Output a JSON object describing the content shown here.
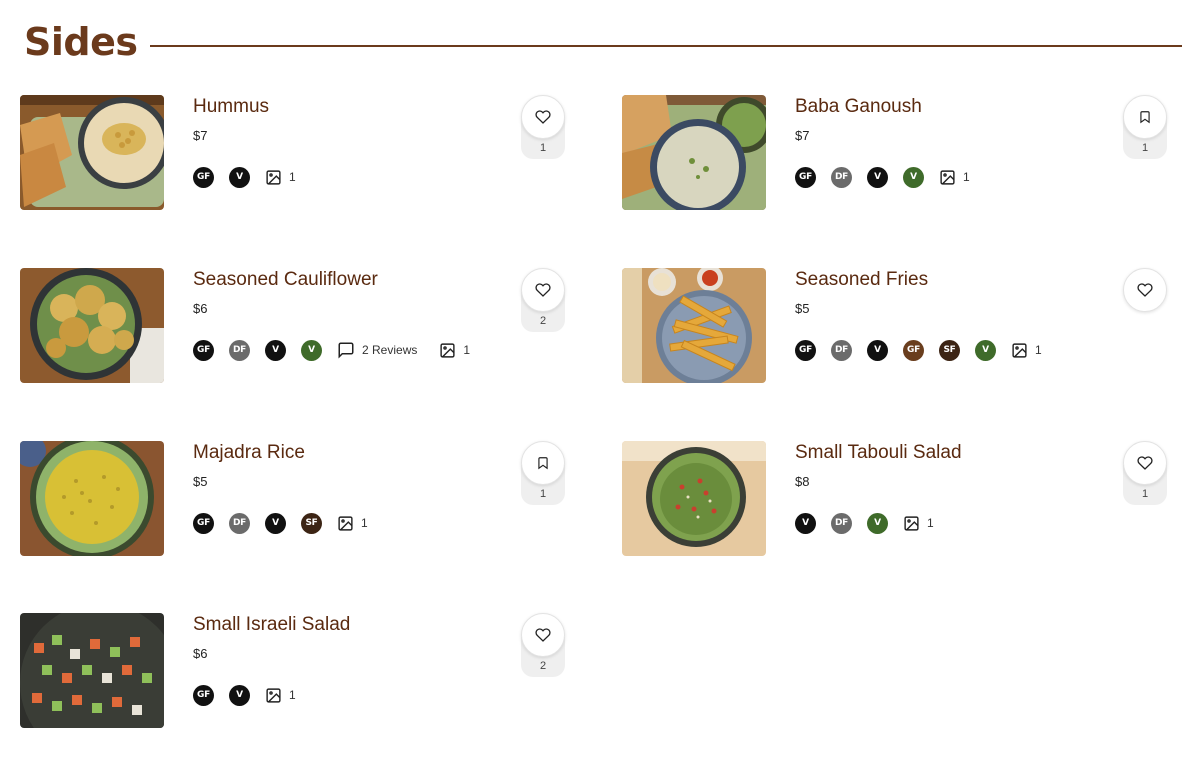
{
  "section": {
    "title": "Sides"
  },
  "colors": {
    "accent": "#6b3a1c",
    "item_name": "#5a2a10"
  },
  "items": [
    {
      "name": "Hummus",
      "price": "$7",
      "badges": [
        "GF",
        "V"
      ],
      "reviews": null,
      "photos": "1",
      "action_icon": "heart-icon",
      "action_count": "1"
    },
    {
      "name": "Baba Ganoush",
      "price": "$7",
      "badges": [
        "GF",
        "DF",
        "V",
        "V"
      ],
      "reviews": null,
      "photos": "1",
      "action_icon": "bookmark-icon",
      "action_count": "1"
    },
    {
      "name": "Seasoned Cauliflower",
      "price": "$6",
      "badges": [
        "GF",
        "DF",
        "V",
        "V"
      ],
      "reviews": "2 Reviews",
      "photos": "1",
      "action_icon": "heart-icon",
      "action_count": "2"
    },
    {
      "name": "Seasoned Fries",
      "price": "$5",
      "badges": [
        "GF",
        "DF",
        "V",
        "GF",
        "SF",
        "V"
      ],
      "reviews": null,
      "photos": "1",
      "action_icon": "heart-icon",
      "action_count": null
    },
    {
      "name": "Majadra Rice",
      "price": "$5",
      "badges": [
        "GF",
        "DF",
        "V",
        "SF"
      ],
      "reviews": null,
      "photos": "1",
      "action_icon": "bookmark-icon",
      "action_count": "1"
    },
    {
      "name": "Small Tabouli Salad",
      "price": "$8",
      "badges": [
        "V",
        "DF",
        "V"
      ],
      "reviews": null,
      "photos": "1",
      "action_icon": "heart-icon",
      "action_count": "1"
    },
    {
      "name": "Small Israeli Salad",
      "price": "$6",
      "badges": [
        "GF",
        "V"
      ],
      "reviews": null,
      "photos": "1",
      "action_icon": "heart-icon",
      "action_count": "2"
    }
  ]
}
